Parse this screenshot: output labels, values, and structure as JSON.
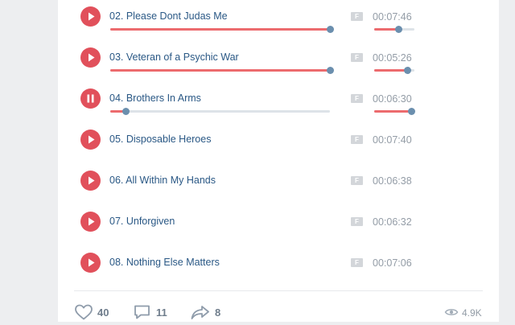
{
  "colors": {
    "accent": "#e1505b",
    "link": "#2a5885",
    "progress": "#ec6b6e",
    "knob": "#6b8fae",
    "muted": "#939ca6"
  },
  "tracks": [
    {
      "title": "02. Please Dont Judas Me",
      "duration": "00:07:46",
      "badge": "F",
      "state": "paused",
      "progress": 1.0,
      "volume": 0.6,
      "icon": "play-icon"
    },
    {
      "title": "03. Veteran of a Psychic War",
      "duration": "00:05:26",
      "badge": "F",
      "state": "paused",
      "progress": 1.0,
      "volume": 0.82,
      "icon": "play-icon"
    },
    {
      "title": "04. Brothers In Arms",
      "duration": "00:06:30",
      "badge": "F",
      "state": "playing",
      "progress": 0.07,
      "volume": 0.92,
      "icon": "pause-icon"
    },
    {
      "title": "05. Disposable Heroes",
      "duration": "00:07:40",
      "badge": "F",
      "state": "idle",
      "icon": "play-icon"
    },
    {
      "title": "06. All Within My Hands",
      "duration": "00:06:38",
      "badge": "F",
      "state": "idle",
      "icon": "play-icon"
    },
    {
      "title": "07. Unforgiven",
      "duration": "00:06:32",
      "badge": "F",
      "state": "idle",
      "icon": "play-icon"
    },
    {
      "title": "08. Nothing Else Matters",
      "duration": "00:07:06",
      "badge": "F",
      "state": "idle",
      "icon": "play-icon"
    }
  ],
  "footer": {
    "likes": "40",
    "comments": "11",
    "shares": "8",
    "views": "4.9K",
    "icons": [
      "heart-icon",
      "comment-icon",
      "share-icon",
      "eye-icon"
    ]
  }
}
